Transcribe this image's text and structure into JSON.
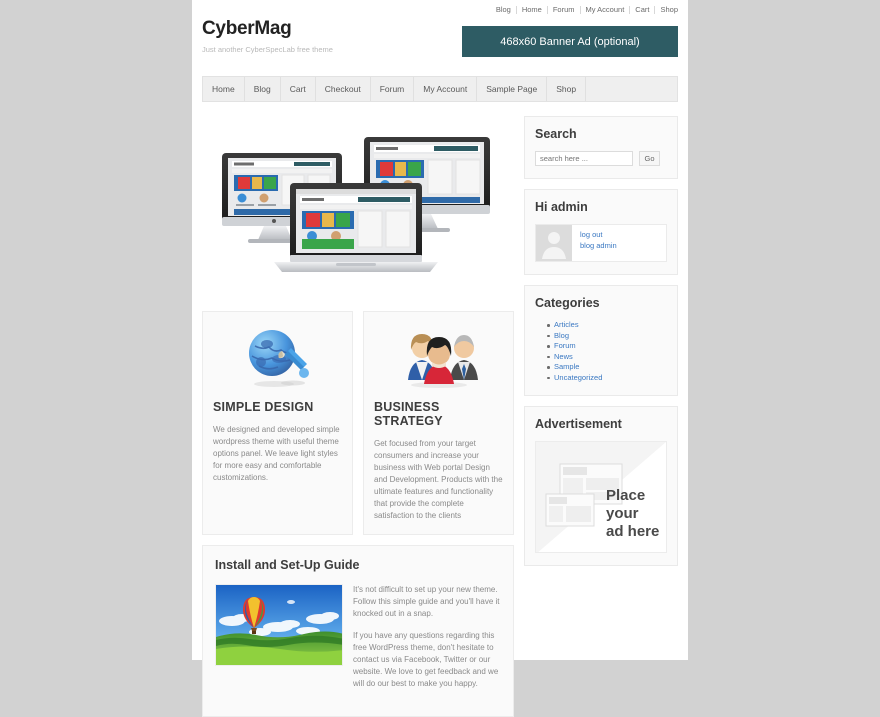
{
  "topbar": {
    "links": [
      {
        "label": "Blog"
      },
      {
        "label": "Home"
      },
      {
        "label": "Forum"
      },
      {
        "label": "My Account"
      },
      {
        "label": "Cart"
      },
      {
        "label": "Shop"
      }
    ]
  },
  "header": {
    "title": "CyberMag",
    "tagline": "Just another CyberSpecLab free theme",
    "banner_label": "468x60 Banner Ad (optional)",
    "banner_color": "#2e5c64"
  },
  "menu": {
    "items": [
      {
        "label": "Home"
      },
      {
        "label": "Blog"
      },
      {
        "label": "Cart"
      },
      {
        "label": "Checkout"
      },
      {
        "label": "Forum"
      },
      {
        "label": "My Account"
      },
      {
        "label": "Sample Page"
      },
      {
        "label": "Shop"
      }
    ]
  },
  "features": [
    {
      "icon": "globe-paintbrush-icon",
      "title": "SIMPLE DESIGN",
      "text": "We designed and developed simple wordpress theme with useful theme options panel. We leave light styles for more easy and comfortable customizations."
    },
    {
      "icon": "business-people-icon",
      "title": "BUSINESS STRATEGY",
      "text": "Get focused from your target consumers and increase your business with Web portal Design and Development. Products with the ultimate features and functionality that provide the complete satisfaction to the clients"
    }
  ],
  "install": {
    "title": "Install and Set-Up Guide",
    "image_alt": "hot-air-balloon-photo",
    "paragraphs": [
      "It's not difficult to set up your new theme. Follow this simple guide and you'll have it knocked out in a snap.",
      "If you have any questions regarding this free WordPress theme, don't hesitate to contact us via Facebook, Twitter or our website. We love to get feedback and we will do our best to make you happy."
    ]
  },
  "sidebar": {
    "search": {
      "title": "Search",
      "placeholder": "search here ...",
      "value": "",
      "button_label": "Go"
    },
    "user": {
      "title": "Hi admin",
      "links": [
        {
          "label": "log out"
        },
        {
          "label": "blog admin"
        }
      ]
    },
    "categories": {
      "title": "Categories",
      "items": [
        {
          "label": "Articles"
        },
        {
          "label": "Blog"
        },
        {
          "label": "Forum"
        },
        {
          "label": "News"
        },
        {
          "label": "Sample"
        },
        {
          "label": "Uncategorized"
        }
      ]
    },
    "advertisement": {
      "title": "Advertisement",
      "placeholder_lines": [
        "Place",
        "your",
        "ad here"
      ]
    }
  },
  "colors": {
    "page_background": "#d2d2d2",
    "content_background": "#ffffff",
    "link": "#3a78c2",
    "widget_background": "#fafafa"
  }
}
